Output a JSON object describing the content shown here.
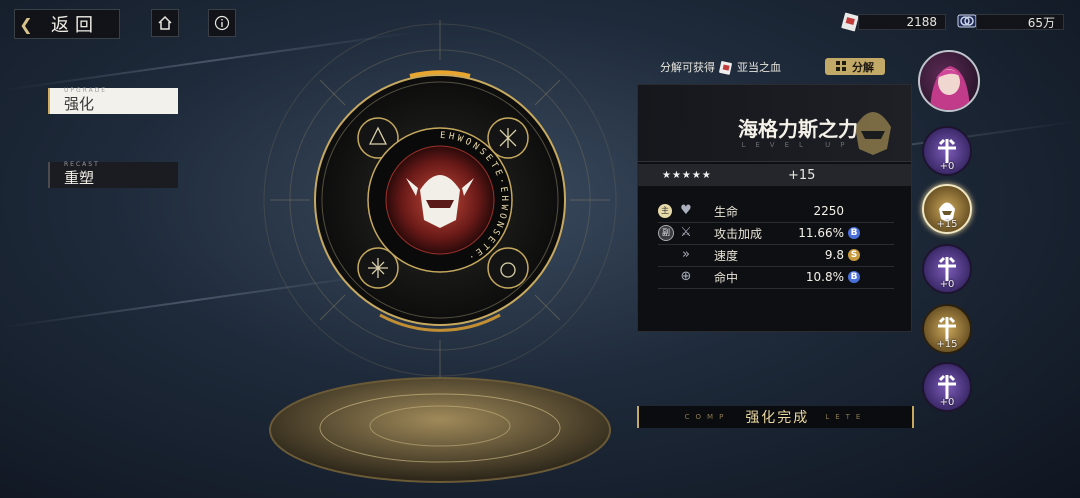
{
  "nav": {
    "back_label": "返回"
  },
  "currency": [
    {
      "icon": "card-ticket-icon",
      "amount": "2188"
    },
    {
      "icon": "coin-stack-icon",
      "amount": "65万"
    }
  ],
  "tabs": [
    {
      "sub": "UPGRADE",
      "label": "强化",
      "active": true
    },
    {
      "sub": "RECAST",
      "label": "重塑",
      "active": false
    }
  ],
  "decompose": {
    "prefix": "分解可获得",
    "item": "亚当之血",
    "button": "分解"
  },
  "item": {
    "name": "海格力斯之力",
    "subtitle": "LEVEL UP",
    "stars": "★★★★★",
    "level": "+15"
  },
  "stats": [
    {
      "badge": "主",
      "icon": "heart-icon",
      "name": "生命",
      "value": "2250",
      "grade": ""
    },
    {
      "badge": "副",
      "icon": "attack-icon",
      "name": "攻击加成",
      "value": "11.66%",
      "grade": "B"
    },
    {
      "badge": "",
      "icon": "speed-icon",
      "name": "速度",
      "value": "9.8",
      "grade": "S"
    },
    {
      "badge": "",
      "icon": "target-icon",
      "name": "命中",
      "value": "10.8%",
      "grade": "B"
    }
  ],
  "complete": {
    "left": "COMP",
    "text": "强化完成",
    "right": "LETE"
  },
  "slots": [
    {
      "kind": "purple",
      "count": "+0",
      "selected": false
    },
    {
      "kind": "gold",
      "count": "+15",
      "selected": true
    },
    {
      "kind": "purple",
      "count": "+0",
      "selected": false
    },
    {
      "kind": "gold",
      "count": "+15",
      "selected": false
    },
    {
      "kind": "purple",
      "count": "+0",
      "selected": false
    }
  ],
  "rune_text": "EHWONSETE·EHWONSETE·",
  "colors": {
    "accent": "#c6a95f",
    "grade_b": "#4a6fd8",
    "grade_s": "#c89a3e"
  }
}
